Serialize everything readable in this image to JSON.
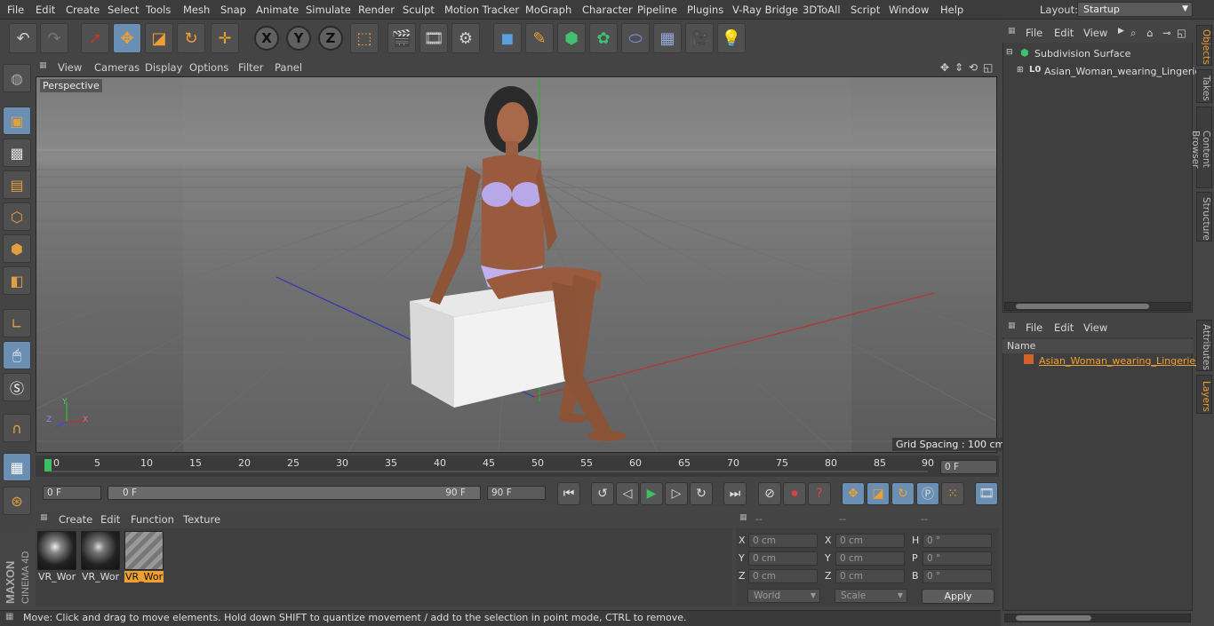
{
  "menubar": {
    "items": [
      "File",
      "Edit",
      "Create",
      "Select",
      "Tools",
      "Mesh",
      "Snap",
      "Animate",
      "Simulate",
      "Render",
      "Sculpt",
      "Motion Tracker",
      "MoGraph",
      "Character",
      "Pipeline",
      "Plugins",
      "V-Ray Bridge",
      "3DToAll",
      "Script",
      "Window",
      "Help"
    ],
    "layout_label": "Layout:",
    "layout_value": "Startup"
  },
  "toolbar": {
    "icons": [
      "undo-icon",
      "redo-icon",
      "select-icon",
      "move-icon",
      "scale-icon",
      "rotate-icon",
      "live-select-icon",
      "x-axis-icon",
      "y-axis-icon",
      "z-axis-icon",
      "coordinate-system-icon",
      "render-view-icon",
      "render-picture-viewer-icon",
      "render-settings-icon",
      "cube-icon",
      "pen-icon",
      "subdivision-icon",
      "cloner-icon",
      "deformer-icon",
      "floor-icon",
      "camera-icon",
      "light-icon"
    ],
    "axis_labels": [
      "X",
      "Y",
      "Z"
    ]
  },
  "viewport": {
    "menu": [
      "View",
      "Cameras",
      "Display",
      "Options",
      "Filter",
      "Panel"
    ],
    "label": "Perspective",
    "grid_spacing": "Grid Spacing : 100 cm",
    "axis_labels": [
      "Y",
      "Z",
      "X"
    ]
  },
  "timeline": {
    "ticks": [
      "0",
      "5",
      "10",
      "15",
      "20",
      "25",
      "30",
      "35",
      "40",
      "45",
      "50",
      "55",
      "60",
      "65",
      "70",
      "75",
      "80",
      "85",
      "90"
    ],
    "current_frame": "0 F",
    "start_frame": "0 F",
    "range_start": "0 F",
    "range_end": "90 F",
    "end_frame": "90 F"
  },
  "material_manager": {
    "menu": [
      "Create",
      "Edit",
      "Function",
      "Texture"
    ],
    "materials": [
      "VR_Wor",
      "VR_Wor",
      "VR_Wor"
    ]
  },
  "coordinates": {
    "headers": [
      "--",
      "--",
      "--"
    ],
    "rows": [
      {
        "axis": "X",
        "pos": "0 cm",
        "size_axis": "X",
        "size": "0 cm",
        "rot_axis": "H",
        "rot": "0 °"
      },
      {
        "axis": "Y",
        "pos": "0 cm",
        "size_axis": "Y",
        "size": "0 cm",
        "rot_axis": "P",
        "rot": "0 °"
      },
      {
        "axis": "Z",
        "pos": "0 cm",
        "size_axis": "Z",
        "size": "0 cm",
        "rot_axis": "B",
        "rot": "0 °"
      }
    ],
    "mode": "World",
    "transform": "Scale",
    "apply_label": "Apply"
  },
  "status": {
    "text": "Move: Click and drag to move elements. Hold down SHIFT to quantize movement / add to the selection in point mode, CTRL to remove."
  },
  "object_manager": {
    "menu": [
      "File",
      "Edit",
      "View"
    ],
    "objects": [
      "Subdivision Surface",
      "Asian_Woman_wearing_Lingerie_"
    ]
  },
  "layer_manager": {
    "menu": [
      "File",
      "Edit",
      "View"
    ],
    "name_header": "Name",
    "layers": [
      "Asian_Woman_wearing_Lingerie_S"
    ]
  },
  "right_tabs": [
    "Objects",
    "Takes",
    "Content Browser",
    "Structure",
    "Attributes",
    "Layers"
  ],
  "branding": "MAXON CINEMA 4D",
  "colors": {
    "accent": "#f0a030",
    "selection_blue": "#6b8fb3",
    "axis_x": "#c03030",
    "axis_y": "#30a030",
    "axis_z": "#3030c0"
  }
}
